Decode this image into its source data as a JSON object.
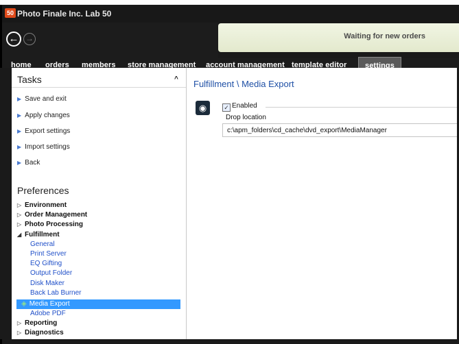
{
  "window": {
    "app_icon_text": "50",
    "title": "Photo Finale Inc. Lab 50"
  },
  "status": {
    "text": "Waiting for new orders"
  },
  "menu": {
    "items": [
      "home",
      "orders",
      "members",
      "store management",
      "account management",
      "template editor",
      "settings"
    ],
    "active": "settings"
  },
  "icons": {
    "back": "back-arrow-icon",
    "forward": "forward-arrow-icon",
    "disc": "disc-icon",
    "collapse": "chevron-up-icon"
  },
  "sidebar": {
    "tasks_title": "Tasks",
    "tasks": [
      "Save and exit",
      "Apply changes",
      "Export settings",
      "Import settings",
      "Back"
    ],
    "preferences_title": "Preferences",
    "tree": {
      "environment": "Environment",
      "order_management": "Order Management",
      "photo_processing": "Photo Processing",
      "fulfillment": "Fulfillment",
      "fulfillment_children": [
        "General",
        "Print Server",
        "EQ Gifting",
        "Output Folder",
        "Disk Maker",
        "Back Lab Burner",
        "Media Export",
        "Adobe PDF"
      ],
      "reporting": "Reporting",
      "diagnostics": "Diagnostics"
    },
    "selected": "Media Export"
  },
  "content": {
    "title": "Fulfillment \\ Media Export",
    "enabled_label": "Enabled",
    "enabled_checked": true,
    "drop_location_label": "Drop location",
    "drop_location_value": "c:\\apm_folders\\cd_cache\\dvd_export\\MediaManager"
  },
  "colors": {
    "accent": "#1e4fa5",
    "selection": "#3399ff",
    "link": "#1f4fc8",
    "status_bg": "#e8edd5"
  }
}
